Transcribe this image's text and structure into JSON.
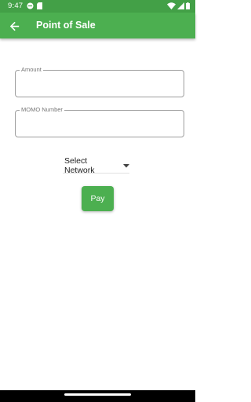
{
  "status_bar": {
    "time": "9:47",
    "icons": [
      "sync-icon",
      "sd-card-icon",
      "wifi-icon",
      "signal-icon",
      "battery-icon"
    ]
  },
  "app_bar": {
    "title": "Point of Sale",
    "back_icon": "arrow-back-icon"
  },
  "form": {
    "amount": {
      "label": "Amount",
      "value": ""
    },
    "momo_number": {
      "label": "MOMO Number",
      "value": ""
    },
    "network_dropdown": {
      "selected": "Select Network",
      "icon": "caret-down-icon"
    },
    "pay_label": "Pay"
  },
  "colors": {
    "primary": "#4caf50",
    "status_bar": "#43a047",
    "field_border": "#9e9e9e",
    "label_gray": "#757575"
  }
}
